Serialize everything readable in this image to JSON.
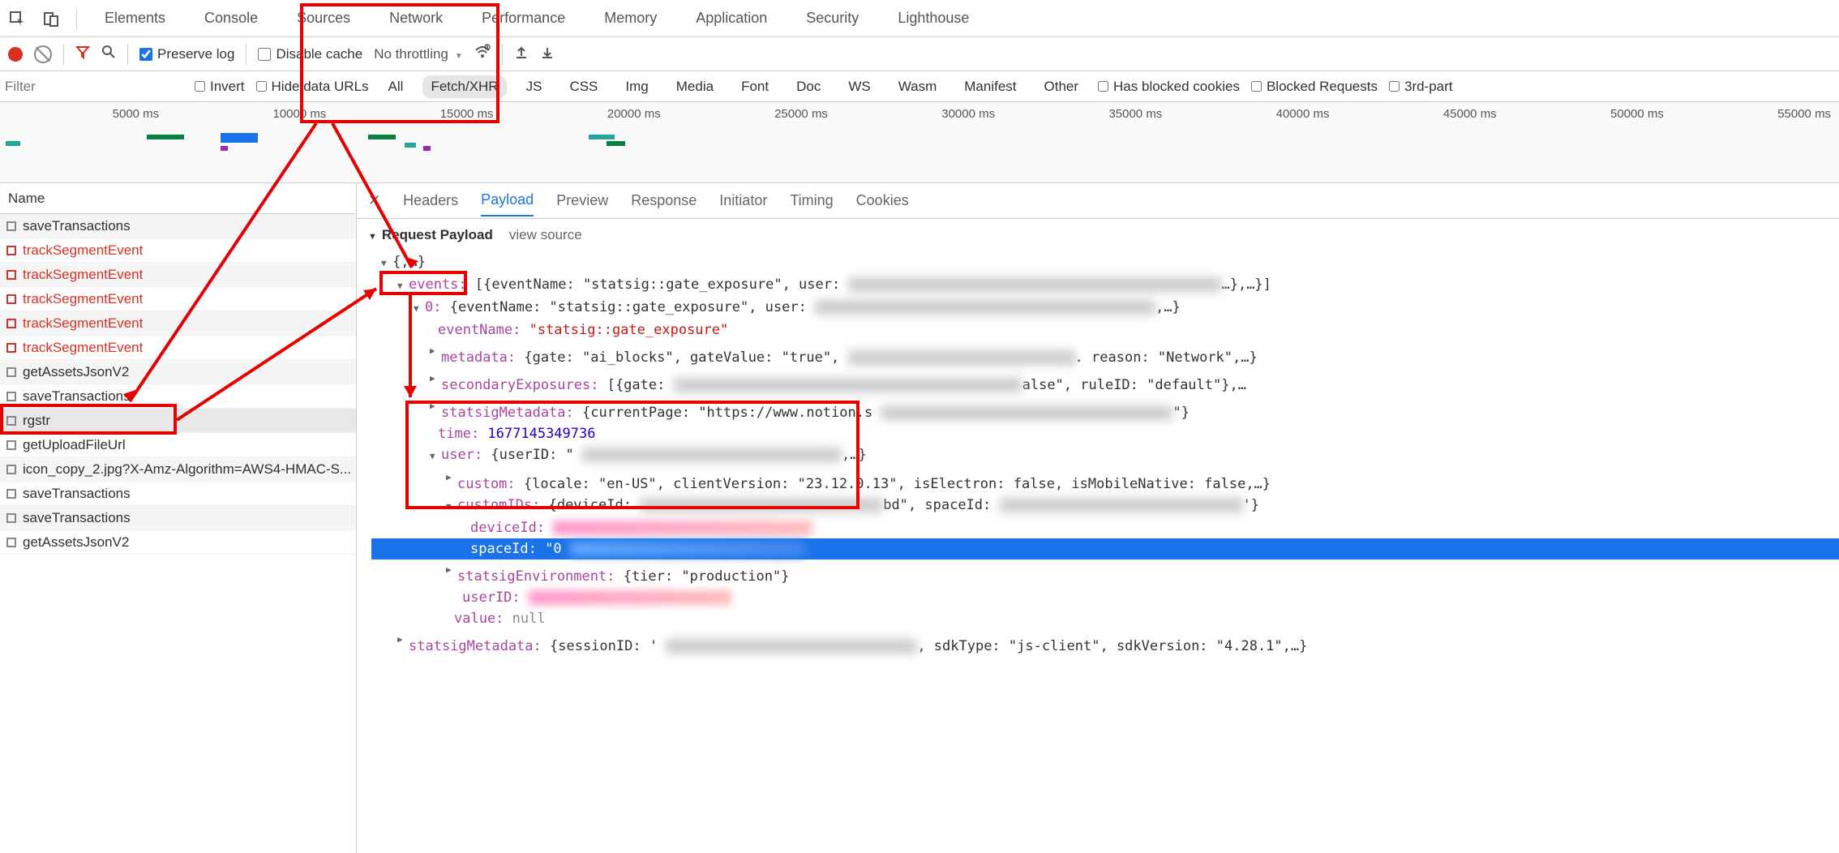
{
  "devtools": {
    "panels": [
      "Elements",
      "Console",
      "Sources",
      "Network",
      "Performance",
      "Memory",
      "Application",
      "Security",
      "Lighthouse"
    ],
    "active_panel": "Network"
  },
  "toolbar": {
    "preserve_log": "Preserve log",
    "disable_cache": "Disable cache",
    "throttling": "No throttling"
  },
  "filterbar": {
    "placeholder": "Filter",
    "invert": "Invert",
    "hide_data_urls": "Hide data URLs",
    "types": [
      "All",
      "Fetch/XHR",
      "JS",
      "CSS",
      "Img",
      "Media",
      "Font",
      "Doc",
      "WS",
      "Wasm",
      "Manifest",
      "Other"
    ],
    "active_type": "Fetch/XHR",
    "has_blocked": "Has blocked cookies",
    "blocked_req": "Blocked Requests",
    "third_party": "3rd-part"
  },
  "timeline": {
    "ticks": [
      "5000 ms",
      "10000 ms",
      "15000 ms",
      "20000 ms",
      "25000 ms",
      "30000 ms",
      "35000 ms",
      "40000 ms",
      "45000 ms",
      "50000 ms",
      "55000 ms"
    ]
  },
  "requests": {
    "header": "Name",
    "list": [
      {
        "name": "saveTransactions",
        "red": false
      },
      {
        "name": "trackSegmentEvent",
        "red": true
      },
      {
        "name": "trackSegmentEvent",
        "red": true
      },
      {
        "name": "trackSegmentEvent",
        "red": true
      },
      {
        "name": "trackSegmentEvent",
        "red": true
      },
      {
        "name": "trackSegmentEvent",
        "red": true
      },
      {
        "name": "getAssetsJsonV2",
        "red": false
      },
      {
        "name": "saveTransactions",
        "red": false
      },
      {
        "name": "rgstr",
        "red": false,
        "selected": true
      },
      {
        "name": "getUploadFileUrl",
        "red": false
      },
      {
        "name": "icon_copy_2.jpg?X-Amz-Algorithm=AWS4-HMAC-S...",
        "red": false
      },
      {
        "name": "saveTransactions",
        "red": false
      },
      {
        "name": "saveTransactions",
        "red": false
      },
      {
        "name": "getAssetsJsonV2",
        "red": false
      }
    ]
  },
  "detail": {
    "tabs": [
      "Headers",
      "Payload",
      "Preview",
      "Response",
      "Initiator",
      "Timing",
      "Cookies"
    ],
    "active_tab": "Payload",
    "section_title": "Request Payload",
    "view_source": "view source",
    "tree": {
      "l_top": "{,…}",
      "l_events_key": "events:",
      "l_events_preview": " [{eventName: \"statsig::gate_exposure\", user:",
      "l_events_tail": "…},…}]",
      "l_0_key": "0:",
      "l_0_preview": " {eventName: \"statsig::gate_exposure\", user:",
      "l_0_tail": ",…}",
      "l_eventName_key": "eventName:",
      "l_eventName_val": " \"statsig::gate_exposure\"",
      "l_metadata_key": "metadata:",
      "l_metadata_val": " {gate: \"ai_blocks\", gateValue: \"true\",",
      "l_metadata_tail": ". reason: \"Network\",…}",
      "l_secExp_key": "secondaryExposures:",
      "l_secExp_val": " [{gate:",
      "l_secExp_tail": "alse\", ruleID: \"default\"},…",
      "l_statsigMeta_key": "statsigMetadata:",
      "l_statsigMeta_val": " {currentPage: \"https://www.notion.s",
      "l_statsigMeta_tail": "\"}",
      "l_time_key": "time:",
      "l_time_val": " 1677145349736",
      "l_user_key": "user:",
      "l_user_val": " {userID: \"",
      "l_user_tail": ",…}",
      "l_custom_key": "custom:",
      "l_custom_val": " {locale: \"en-US\", clientVersion: \"23.12.0.13\", isElectron: false, isMobileNative: false,…}",
      "l_customIDs_key": "customIDs:",
      "l_customIDs_val": " {deviceId:",
      "l_customIDs_tail": "bd\", spaceId:",
      "l_customIDs_tail2": "'}",
      "l_deviceId_key": "deviceId:",
      "l_spaceId_key": "spaceId:",
      "l_spaceId_val": " \"0",
      "l_statsigEnv_key": "statsigEnvironment:",
      "l_statsigEnv_val": " {tier: \"production\"}",
      "l_userID_key": "userID:",
      "l_value_key": "value:",
      "l_value_val": " null",
      "l_outerStatsig_key": "statsigMetadata:",
      "l_outerStatsig_val": " {sessionID: '",
      "l_outerStatsig_tail": ", sdkType: \"js-client\", sdkVersion: \"4.28.1\",…}"
    }
  }
}
